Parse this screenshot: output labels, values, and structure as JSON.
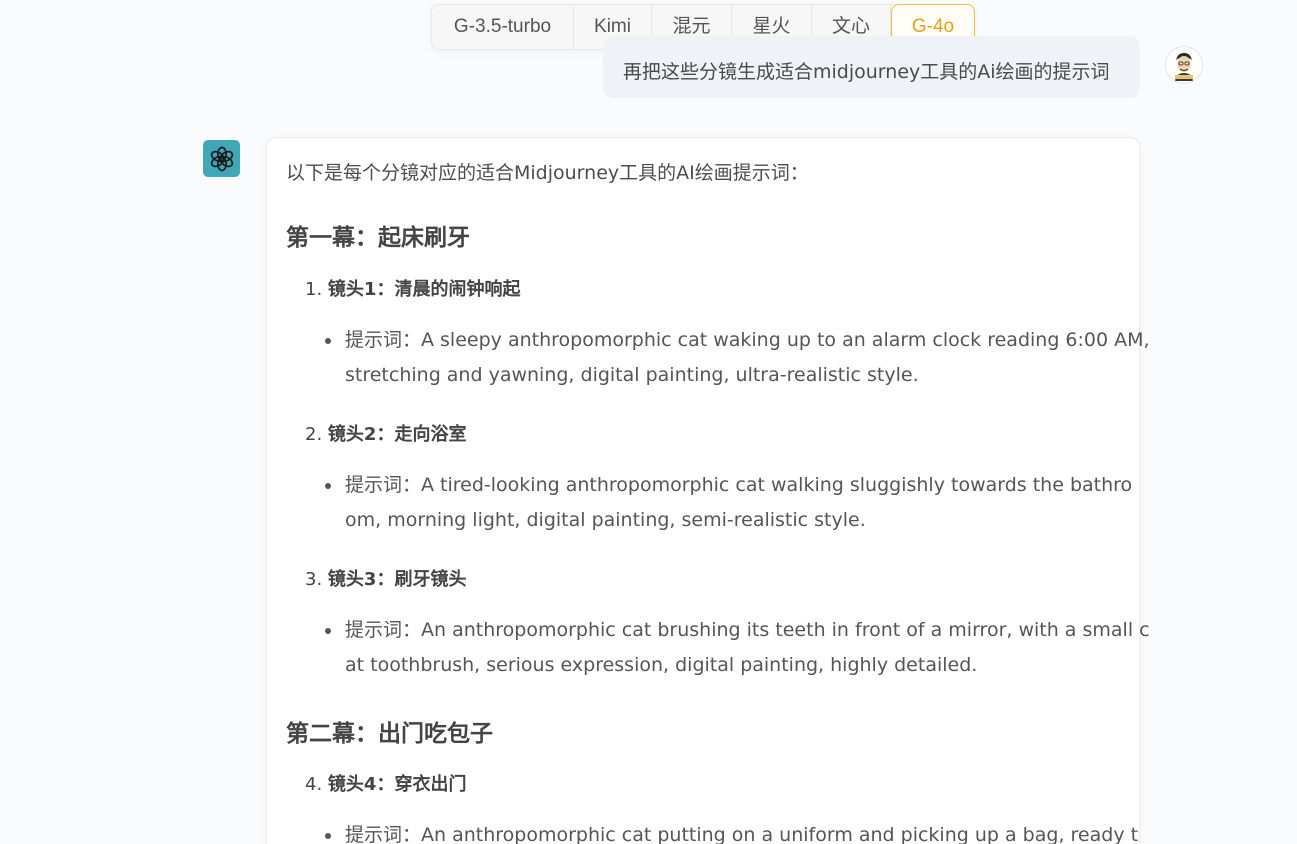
{
  "model_tabs": [
    {
      "label": "G-3.5-turbo",
      "active": false
    },
    {
      "label": "Kimi",
      "active": false
    },
    {
      "label": "混元",
      "active": false
    },
    {
      "label": "星火",
      "active": false
    },
    {
      "label": "文心",
      "active": false
    },
    {
      "label": "G-4o",
      "active": true
    }
  ],
  "colors": {
    "active_tab": "#e3a21a",
    "bot_icon_bg": "#3fa7b5",
    "user_bubble_bg": "#eff3f8"
  },
  "user_message": {
    "text": "再把这些分镜生成适合midjourney工具的Ai绘画的提示词",
    "avatar": "user-avatar-icon"
  },
  "bot_message": {
    "icon": "openai-logo-icon",
    "intro": "以下是每个分镜对应的适合Midjourney工具的AI绘画提示词：",
    "acts": [
      {
        "title": "第一幕：起床刷牙",
        "shots": [
          {
            "num": "1.",
            "label": "镜头1：清晨的闹钟响起",
            "prompt_lines": [
              "提示词：A sleepy anthropomorphic cat waking up to an alarm clock reading 6:00 AM,",
              "stretching and yawning, digital painting, ultra-realistic style."
            ]
          },
          {
            "num": "2.",
            "label": "镜头2：走向浴室",
            "prompt_lines": [
              "提示词：A tired-looking anthropomorphic cat walking sluggishly towards the bathro",
              "om, morning light, digital painting, semi-realistic style."
            ]
          },
          {
            "num": "3.",
            "label": "镜头3：刷牙镜头",
            "prompt_lines": [
              "提示词：An anthropomorphic cat brushing its teeth in front of a mirror, with a small c",
              "at toothbrush, serious expression, digital painting, highly detailed."
            ]
          }
        ]
      },
      {
        "title": "第二幕：出门吃包子",
        "shots": [
          {
            "num": "4.",
            "label": "镜头4：穿衣出门",
            "prompt_lines": [
              "提示词：An anthropomorphic cat putting on a uniform and picking up a bag, ready t"
            ]
          }
        ]
      }
    ]
  }
}
